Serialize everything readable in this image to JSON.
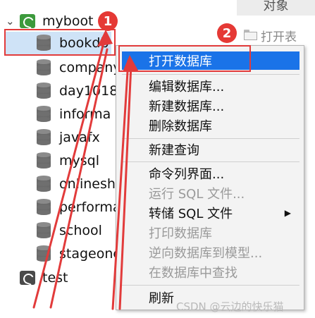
{
  "corner_tab": "对象",
  "toolbar": {
    "open_table_label": "打开表"
  },
  "tree": {
    "connection_label": "myboot",
    "databases": [
      "bookdb",
      "company",
      "day1018",
      "informa",
      "javafx",
      "mysql",
      "onlinesh",
      "performa",
      "school",
      "stageone"
    ],
    "test_connection_label": "test"
  },
  "badges": [
    "1",
    "2"
  ],
  "menu": {
    "items": [
      {
        "label": "打开数据库",
        "state": "highlighted"
      },
      {
        "label": "编辑数据库...",
        "state": "enabled"
      },
      {
        "label": "新建数据库...",
        "state": "enabled"
      },
      {
        "label": "删除数据库",
        "state": "enabled"
      },
      {
        "label": "新建查询",
        "state": "enabled"
      },
      {
        "label": "命令列界面...",
        "state": "enabled"
      },
      {
        "label": "运行 SQL 文件...",
        "state": "disabled"
      },
      {
        "label": "转储 SQL 文件",
        "state": "enabled",
        "submenu": true
      },
      {
        "label": "打印数据库",
        "state": "disabled"
      },
      {
        "label": "逆向数据库到模型...",
        "state": "disabled"
      },
      {
        "label": "在数据库中查找",
        "state": "disabled"
      },
      {
        "label": "刷新",
        "state": "enabled"
      }
    ]
  },
  "watermark": "CSDN @云边的快乐猫",
  "colors": {
    "highlight": "#1a73e8",
    "annotation_red": "#e23b3b",
    "selection": "#cfe3f7"
  }
}
